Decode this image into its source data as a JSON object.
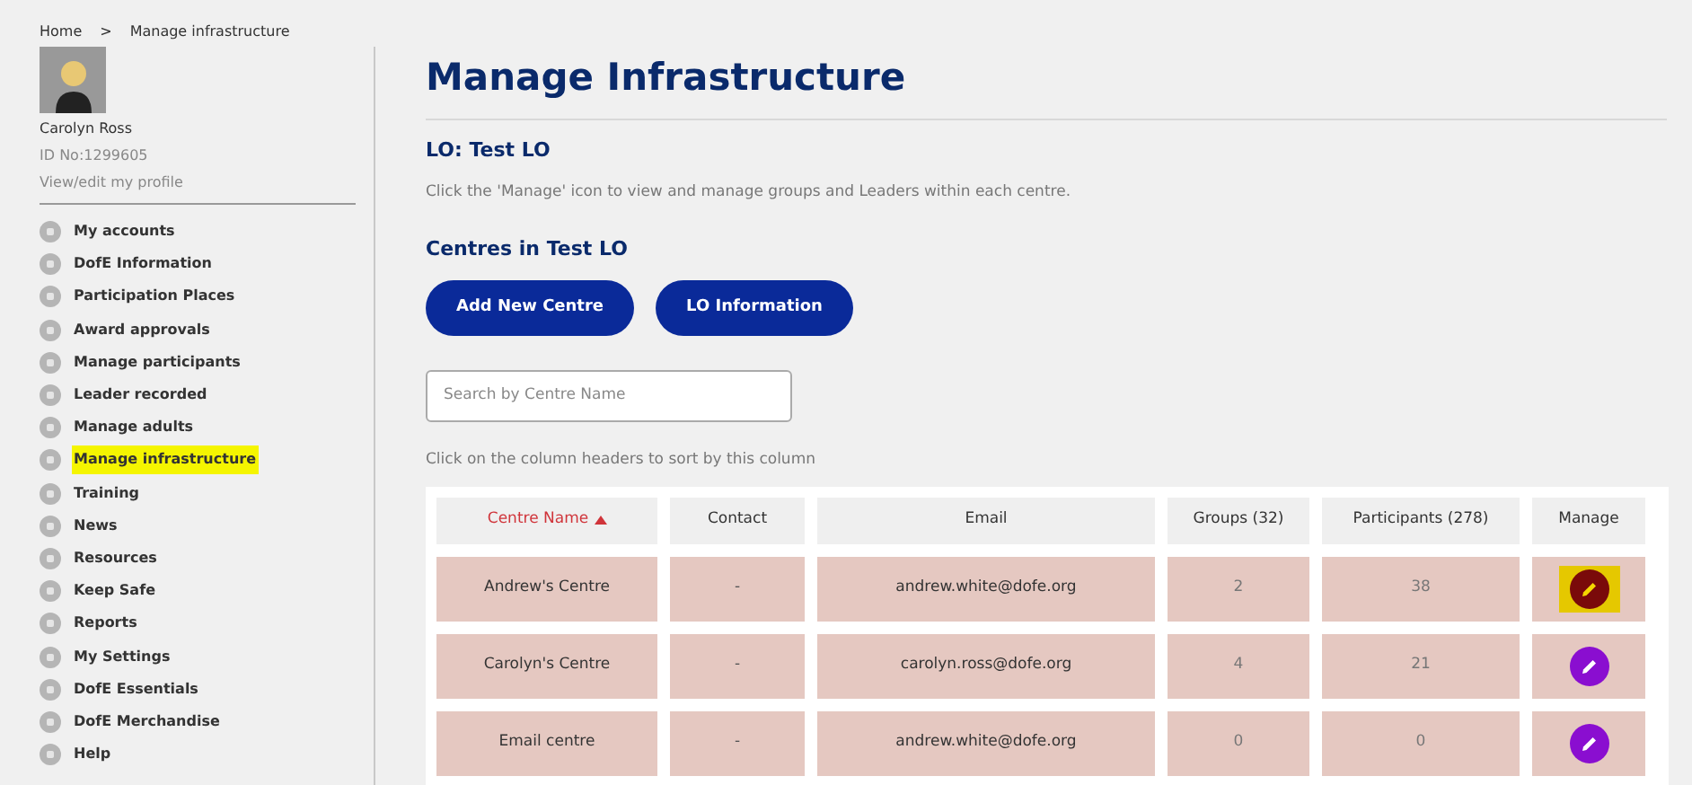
{
  "breadcrumb": [
    {
      "label": "Home"
    },
    {
      "label": "Manage infrastructure"
    }
  ],
  "breadcrumb_separator": ">",
  "profile": {
    "name": "Carolyn Ross",
    "id": "ID No:1299605",
    "link": "View/edit my profile"
  },
  "sidebar": {
    "items": [
      {
        "label": "My accounts",
        "selected": false
      },
      {
        "label": "DofE Information",
        "selected": false
      },
      {
        "label": "Participation Places",
        "selected": false
      },
      {
        "label": "Award approvals",
        "selected": false
      },
      {
        "label": "Manage participants",
        "selected": false
      },
      {
        "label": "Leader recorded",
        "selected": false
      },
      {
        "label": "Manage adults",
        "selected": false
      },
      {
        "label": "Manage infrastructure",
        "selected": true
      },
      {
        "label": "Training",
        "selected": false
      },
      {
        "label": "News",
        "selected": false
      },
      {
        "label": "Resources",
        "selected": false
      },
      {
        "label": "Keep Safe",
        "selected": false
      },
      {
        "label": "Reports",
        "selected": false
      },
      {
        "label": "My Settings",
        "selected": false
      },
      {
        "label": "DofE Essentials",
        "selected": false
      },
      {
        "label": "DofE Merchandise",
        "selected": false
      },
      {
        "label": "Help",
        "selected": false
      }
    ]
  },
  "title": "Manage Infrastructure",
  "lo_heading": "LO: Test LO",
  "instructions": "Click the 'Manage' icon to view and manage groups and Leaders within each centre.",
  "centres_heading": "Centres in Test LO",
  "buttons": [
    "Add New Centre",
    "LO Information"
  ],
  "search": {
    "placeholder": "Search by Centre Name"
  },
  "sort_hint": "Click on the column headers to sort by this column",
  "table": {
    "columns": [
      {
        "label": "Centre Name",
        "sorted": true
      },
      {
        "label": "Contact",
        "sorted": false
      },
      {
        "label": "Email",
        "sorted": false
      },
      {
        "label": "Groups (32)",
        "sorted": false
      },
      {
        "label": "Participants (278)",
        "sorted": false
      },
      {
        "label": "Manage",
        "sorted": false
      }
    ],
    "rows": [
      {
        "centre": "Andrew's Centre",
        "contact": "-",
        "email": "andrew.white@dofe.org",
        "groups": "2",
        "participants": "38",
        "manage_highlighted": true
      },
      {
        "centre": "Carolyn's Centre",
        "contact": "-",
        "email": "carolyn.ross@dofe.org",
        "groups": "4",
        "participants": "21",
        "manage_highlighted": false
      },
      {
        "centre": "Email centre",
        "contact": "-",
        "email": "andrew.white@dofe.org",
        "groups": "0",
        "participants": "0",
        "manage_highlighted": false
      }
    ]
  }
}
